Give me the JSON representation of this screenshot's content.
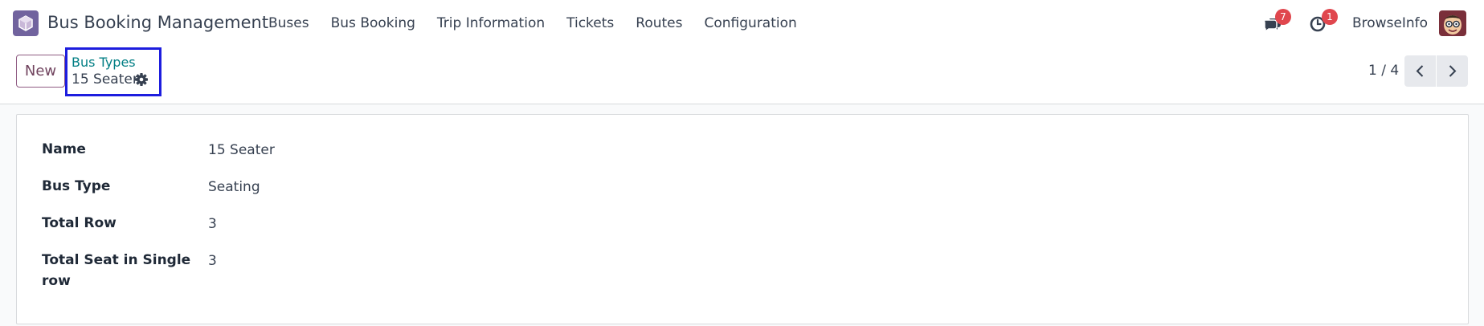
{
  "navbar": {
    "app_title": "Bus Booking Management",
    "menu": [
      {
        "label": "Buses"
      },
      {
        "label": "Bus Booking"
      },
      {
        "label": "Trip Information"
      },
      {
        "label": "Tickets"
      },
      {
        "label": "Routes"
      },
      {
        "label": "Configuration"
      }
    ],
    "messages_count": "7",
    "activities_count": "1",
    "user_name": "BrowseInfo"
  },
  "control_panel": {
    "new_label": "New",
    "breadcrumb_parent": "Bus Types",
    "breadcrumb_current": "15 Seater",
    "pager_value": "1 / 4"
  },
  "form": {
    "fields": [
      {
        "label": "Name",
        "value": "15 Seater"
      },
      {
        "label": "Bus Type",
        "value": "Seating"
      },
      {
        "label": "Total Row",
        "value": "3"
      },
      {
        "label": "Total Seat in Single row",
        "value": "3"
      }
    ]
  },
  "colors": {
    "brand": "#71639e",
    "primary": "#71445f",
    "link": "#017e84",
    "badge": "#e0474e",
    "highlight_box": "#1d1dde"
  },
  "icons": [
    "app-logo-icon",
    "chat-icon",
    "clock-icon",
    "user-avatar",
    "gear-icon",
    "chevron-left-icon",
    "chevron-right-icon"
  ]
}
